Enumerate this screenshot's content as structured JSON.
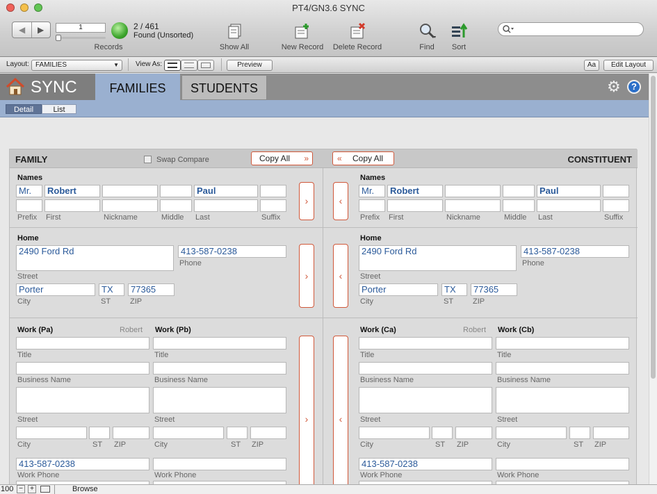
{
  "window": {
    "title": "PT4/GN3.6 SYNC"
  },
  "toolbar": {
    "record_number": "1",
    "records_label": "Records",
    "record_count": "2 / 461",
    "found_status": "Found (Unsorted)",
    "show_all": "Show All",
    "new_record": "New Record",
    "delete_record": "Delete Record",
    "find": "Find",
    "sort": "Sort",
    "search_placeholder": ""
  },
  "layout_bar": {
    "layout_label": "Layout:",
    "layout_value": "FAMILIES",
    "view_as_label": "View As:",
    "preview": "Preview",
    "aa": "Aa",
    "edit_layout": "Edit Layout"
  },
  "nav": {
    "home_label": "SYNC",
    "tabs": [
      "FAMILIES",
      "STUDENTS"
    ],
    "subtabs": [
      "Detail",
      "List"
    ]
  },
  "panel": {
    "family_header": "FAMILY",
    "swap_compare": "Swap Compare",
    "copy_all": "Copy All",
    "constituent_header": "CONSTITUENT"
  },
  "labels": {
    "names": "Names",
    "prefix": "Prefix",
    "first": "First",
    "nickname": "Nickname",
    "middle": "Middle",
    "last": "Last",
    "suffix": "Suffix",
    "home": "Home",
    "street": "Street",
    "phone": "Phone",
    "city": "City",
    "st": "ST",
    "zip": "ZIP",
    "title": "Title",
    "business_name": "Business Name",
    "work_phone": "Work Phone"
  },
  "family": {
    "prefix": "Mr.",
    "first": "Robert",
    "last": "Paul",
    "street": "2490 Ford Rd",
    "phone": "413-587-0238",
    "city": "Porter",
    "st": "TX",
    "zip": "77365",
    "work_a_label": "Work (Pa)",
    "work_a_name": "Robert",
    "work_b_label": "Work (Pb)",
    "work_phone": "413-587-0238"
  },
  "constituent": {
    "prefix": "Mr.",
    "first": "Robert",
    "last": "Paul",
    "street": "2490 Ford Rd",
    "phone": "413-587-0238",
    "city": "Porter",
    "st": "TX",
    "zip": "77365",
    "work_a_label": "Work (Ca)",
    "work_a_name": "Robert",
    "work_b_label": "Work (Cb)",
    "work_phone": "413-587-0238"
  },
  "status_bar": {
    "zoom": "100",
    "mode": "Browse"
  },
  "colors": {
    "accent_blue": "#9ab0d0",
    "copy_orange": "#d0583a",
    "field_text": "#2b5a9a"
  }
}
